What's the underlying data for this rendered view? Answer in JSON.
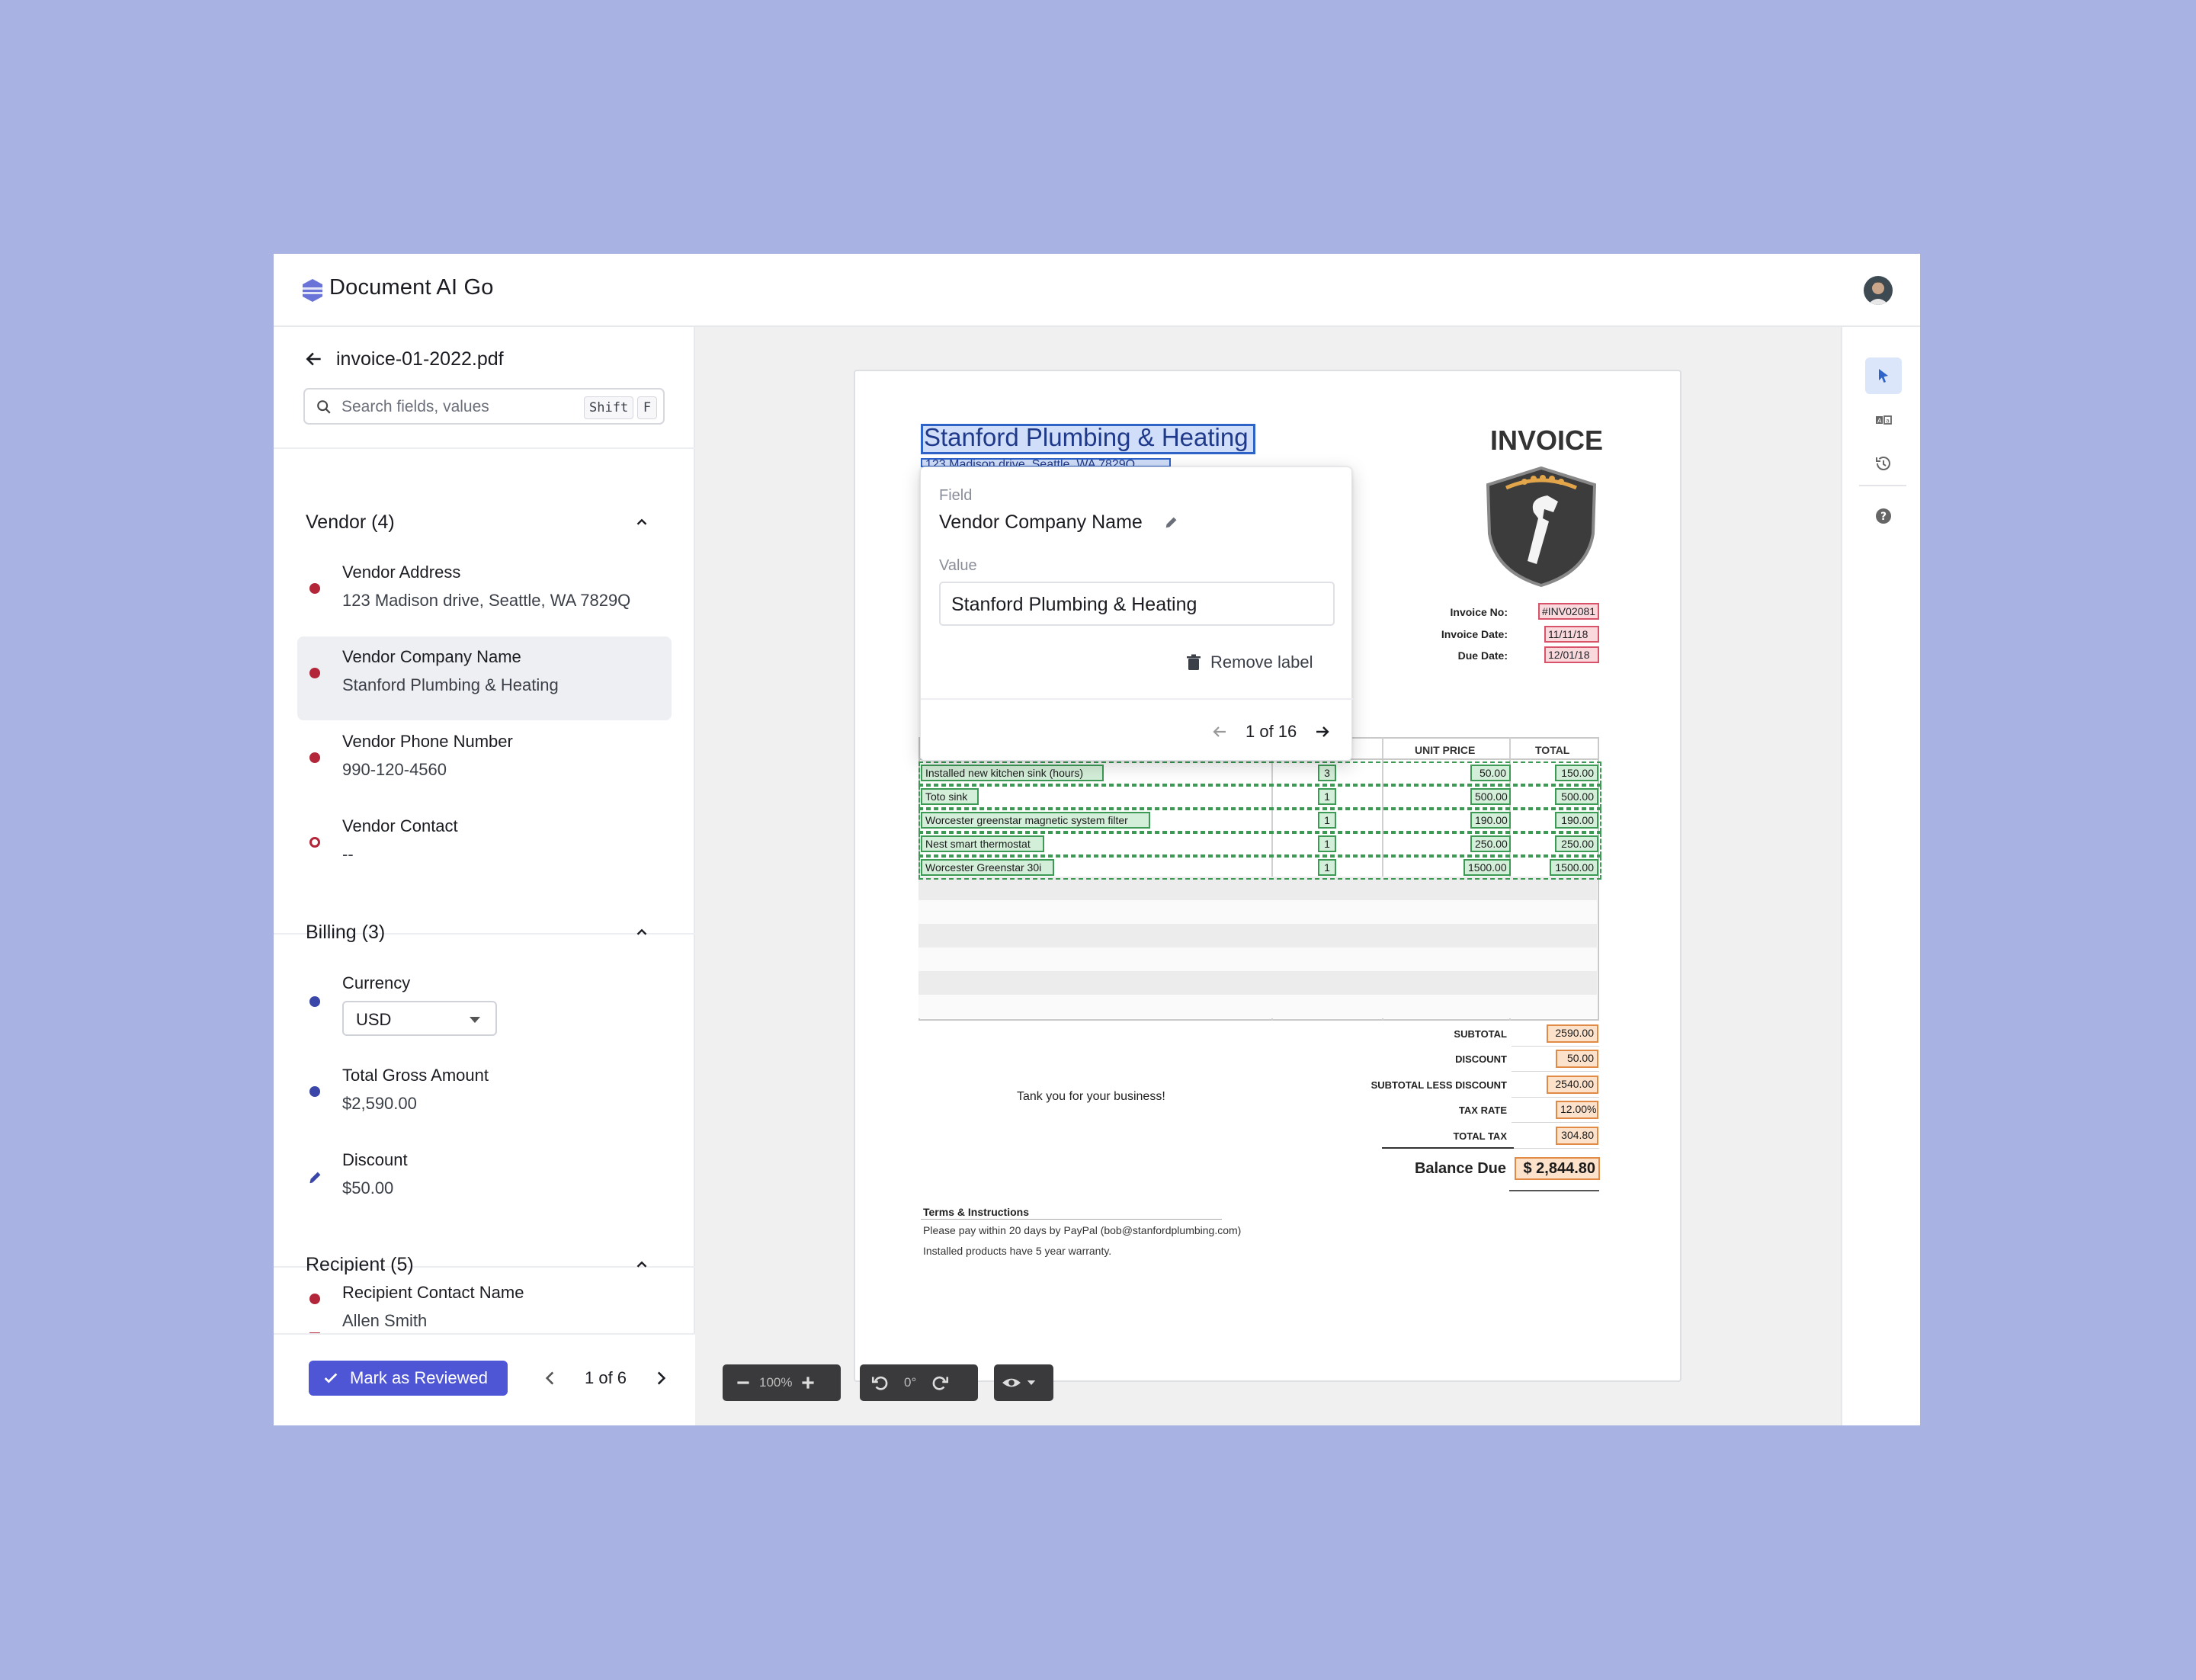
{
  "app": {
    "title": "Document AI Go"
  },
  "sidebar": {
    "filename": "invoice-01-2022.pdf",
    "search_placeholder": "Search fields, values",
    "shortcut_shift": "Shift",
    "shortcut_key": "F",
    "sections": {
      "vendor": {
        "title": "Vendor (4)",
        "fields": [
          {
            "label": "Vendor Address",
            "value": "123 Madison drive, Seattle, WA 7829Q"
          },
          {
            "label": "Vendor Company Name",
            "value": "Stanford Plumbing & Heating"
          },
          {
            "label": "Vendor Phone Number",
            "value": "990-120-4560"
          },
          {
            "label": "Vendor Contact",
            "value": "--"
          }
        ]
      },
      "billing": {
        "title": "Billing (3)",
        "fields": [
          {
            "label": "Currency",
            "value": "USD"
          },
          {
            "label": "Total Gross Amount",
            "value": "$2,590.00"
          },
          {
            "label": "Discount",
            "value": "$50.00"
          }
        ]
      },
      "recipient": {
        "title": "Recipient (5)",
        "fields": [
          {
            "label": "Recipient Contact Name",
            "value": "Allen Smith"
          }
        ]
      }
    },
    "mark_reviewed": "Mark as Reviewed",
    "pager": "1 of 6"
  },
  "popover": {
    "field_label": "Field",
    "field_name": "Vendor Company Name",
    "value_label": "Value",
    "value": "Stanford Plumbing & Heating",
    "remove": "Remove label",
    "nav": "1 of 16"
  },
  "document": {
    "company": "Stanford Plumbing & Heating",
    "address_partial": "123 Madison drive, Seattle, WA 7829Q",
    "title": "INVOICE",
    "meta": [
      {
        "label": "Invoice No:",
        "value": "#INV02081"
      },
      {
        "label": "Invoice Date:",
        "value": "11/11/18"
      },
      {
        "label": "Due Date:",
        "value": "12/01/18"
      }
    ],
    "col_unit_price": "UNIT PRICE",
    "col_total": "TOTAL",
    "items": [
      {
        "desc": "Installed new kitchen sink (hours)",
        "qty": "3",
        "price": "50.00",
        "total": "150.00"
      },
      {
        "desc": "Toto sink",
        "qty": "1",
        "price": "500.00",
        "total": "500.00"
      },
      {
        "desc": "Worcester greenstar magnetic system filter",
        "qty": "1",
        "price": "190.00",
        "total": "190.00"
      },
      {
        "desc": "Nest smart thermostat",
        "qty": "1",
        "price": "250.00",
        "total": "250.00"
      },
      {
        "desc": "Worcester Greenstar 30i",
        "qty": "1",
        "price": "1500.00",
        "total": "1500.00"
      }
    ],
    "summary": [
      {
        "label": "SUBTOTAL",
        "value": "2590.00"
      },
      {
        "label": "DISCOUNT",
        "value": "50.00"
      },
      {
        "label": "SUBTOTAL LESS DISCOUNT",
        "value": "2540.00"
      },
      {
        "label": "TAX RATE",
        "value": "12.00%"
      },
      {
        "label": "TOTAL TAX",
        "value": "304.80"
      }
    ],
    "balance_label": "Balance Due",
    "balance_value": "$ 2,844.80",
    "thanks": "Tank you for your business!",
    "terms_title": "Terms & Instructions",
    "terms_1": "Please pay within 20 days by PayPal (bob@stanfordplumbing.com)",
    "terms_2": "Installed products have 5 year warranty."
  },
  "toolbar": {
    "zoom": "100%",
    "rotation": "0°"
  },
  "colors": {
    "accent": "#4e56d6",
    "required_dot": "#b3263a",
    "optional_dot": "#3a46a8",
    "background": "#a8b3e4"
  }
}
